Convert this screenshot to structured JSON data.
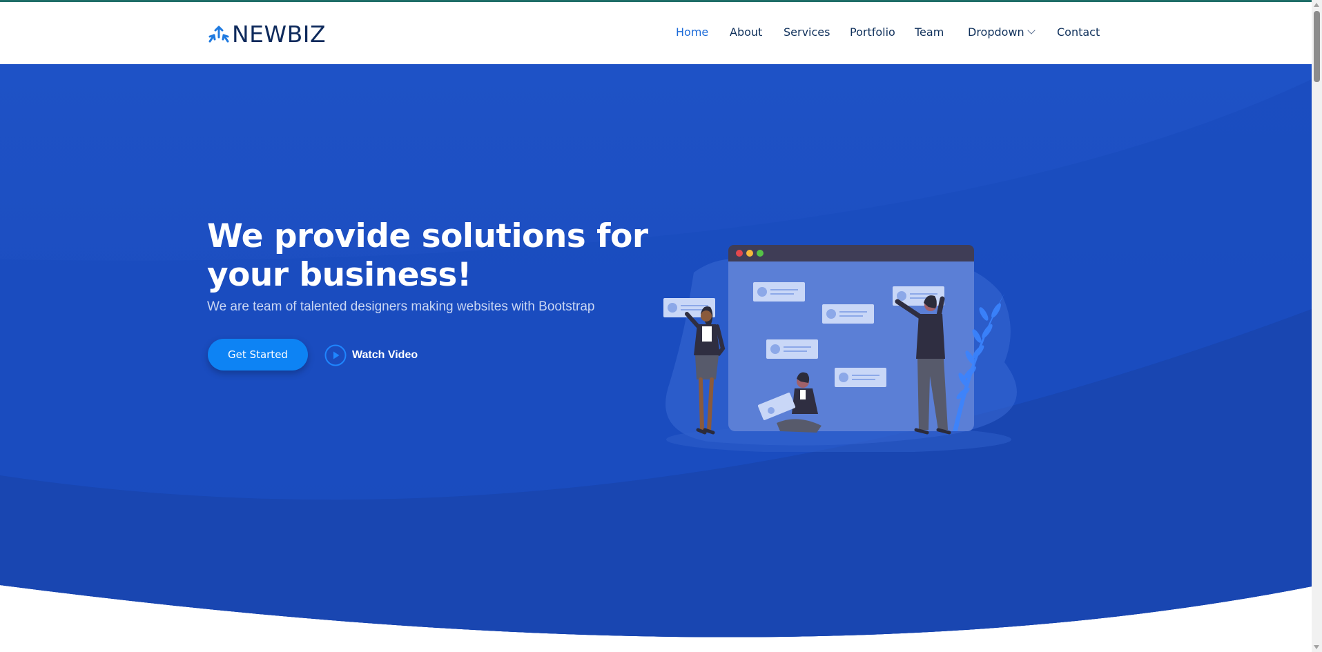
{
  "brand": {
    "name": "NEWBIZ",
    "icon": "arrows-split-icon",
    "color": "#0e2a5c",
    "accent": "#1b6ad8"
  },
  "nav": {
    "items": [
      {
        "label": "Home",
        "active": true
      },
      {
        "label": "About"
      },
      {
        "label": "Services"
      },
      {
        "label": "Portfolio"
      },
      {
        "label": "Team"
      },
      {
        "label": "Dropdown",
        "icon": "chevron-down-icon"
      },
      {
        "label": "Contact"
      }
    ]
  },
  "hero": {
    "title": "We provide solutions for your business!",
    "subtitle": "We are team of talented designers making websites with Bootstrap",
    "primary_button": "Get Started",
    "video_link": "Watch Video",
    "video_icon": "play-circle-icon",
    "illustration": "team-collaboration-illustration",
    "colors": {
      "background": "#1d50c4",
      "button": "#0d83f4"
    }
  }
}
